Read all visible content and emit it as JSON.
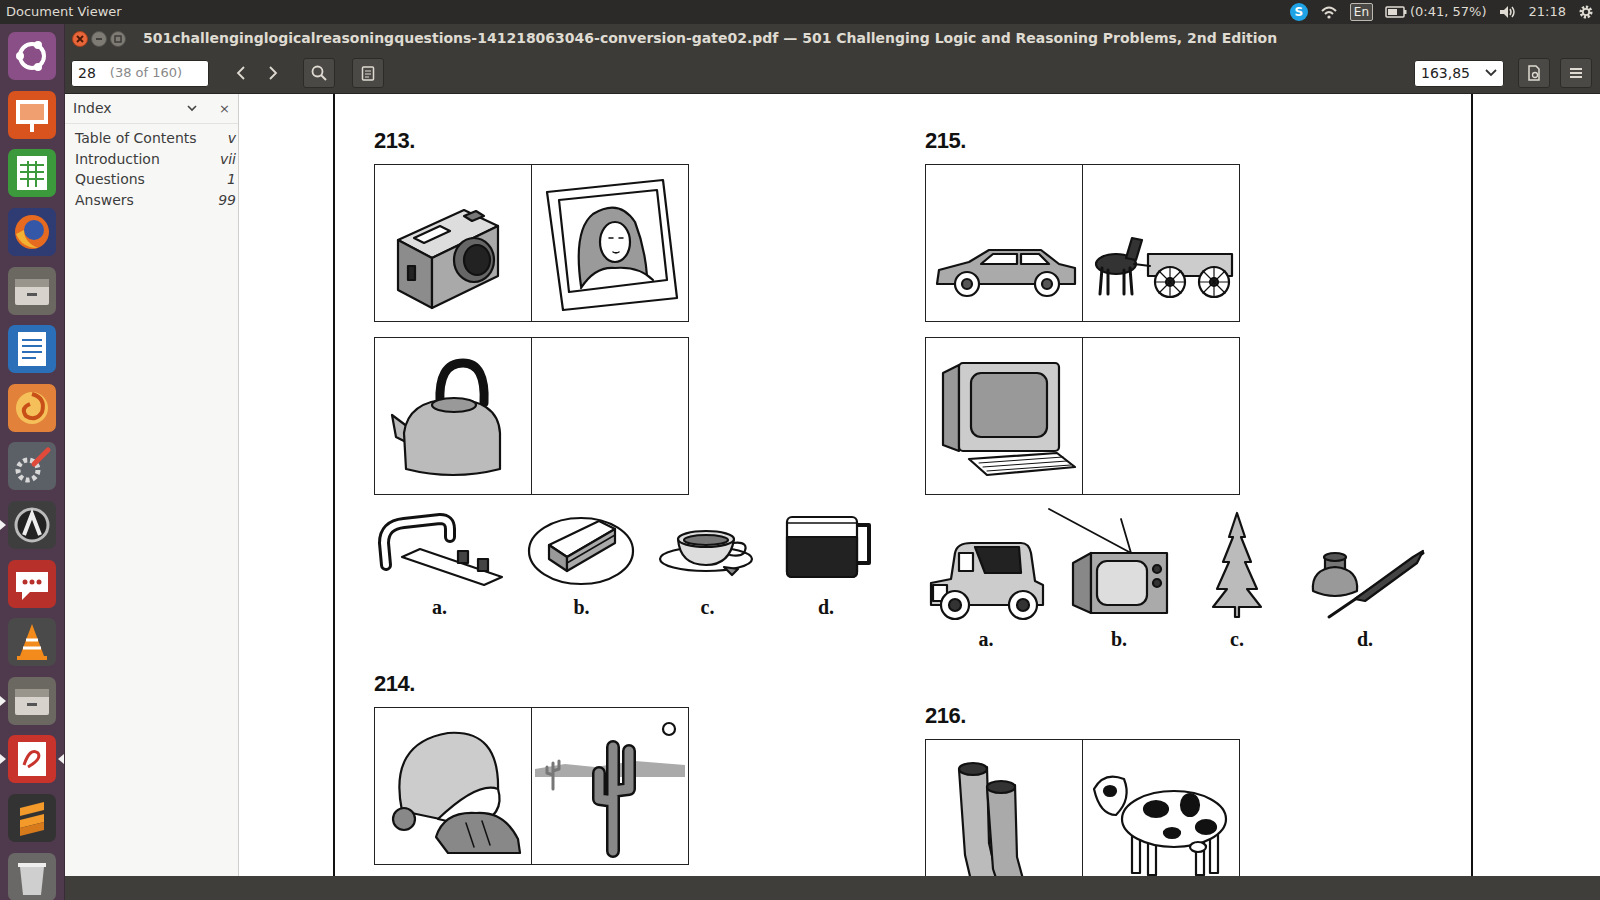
{
  "topbar": {
    "app": "Document Viewer",
    "tray": {
      "skype": "S",
      "keyboard": "En",
      "battery": "(0:41, 57%)",
      "clock": "21:18"
    }
  },
  "launcher": [
    {
      "running": false,
      "active": false
    },
    {
      "running": false,
      "active": false
    },
    {
      "running": false,
      "active": false
    },
    {
      "running": false,
      "active": false
    },
    {
      "running": false,
      "active": false
    },
    {
      "running": false,
      "active": false
    },
    {
      "running": false,
      "active": false
    },
    {
      "running": false,
      "active": false
    },
    {
      "running": true,
      "active": false
    },
    {
      "running": false,
      "active": false
    },
    {
      "running": false,
      "active": false
    },
    {
      "running": true,
      "active": false
    },
    {
      "running": true,
      "active": true
    },
    {
      "running": false,
      "active": false
    },
    {
      "running": false,
      "active": false
    }
  ],
  "window": {
    "title": "501challenginglogicalreasoningquestions-141218063046-conversion-gate02.pdf — 501 Challenging Logic and Reasoning Problems, 2nd Edition"
  },
  "toolbar": {
    "page": "28",
    "page_of": "(38 of 160)",
    "zoom": "163,85"
  },
  "sidebar": {
    "title": "Index",
    "close": "×",
    "items": [
      {
        "label": "Table of Contents",
        "page": "v",
        "selected": false
      },
      {
        "label": "Introduction",
        "page": "vii",
        "selected": false
      },
      {
        "label": "Questions",
        "page": "1",
        "selected": false
      },
      {
        "label": "Answers",
        "page": "99",
        "selected": false
      }
    ]
  },
  "questions": [
    {
      "number": "213.",
      "cells": [
        {
          "empty": false
        },
        {
          "empty": false
        },
        {
          "empty": false
        },
        {
          "empty": true
        }
      ],
      "options": [
        "a.",
        "b.",
        "c.",
        "d."
      ]
    },
    {
      "number": "214.",
      "cells": [
        {
          "empty": false
        },
        {
          "empty": false
        }
      ],
      "options": []
    },
    {
      "number": "215.",
      "cells": [
        {
          "empty": false
        },
        {
          "empty": false
        },
        {
          "empty": false
        },
        {
          "empty": true
        }
      ],
      "options": [
        "a.",
        "b.",
        "c.",
        "d."
      ]
    },
    {
      "number": "216.",
      "cells": [
        {
          "empty": false
        },
        {
          "empty": false
        }
      ],
      "options": []
    }
  ]
}
